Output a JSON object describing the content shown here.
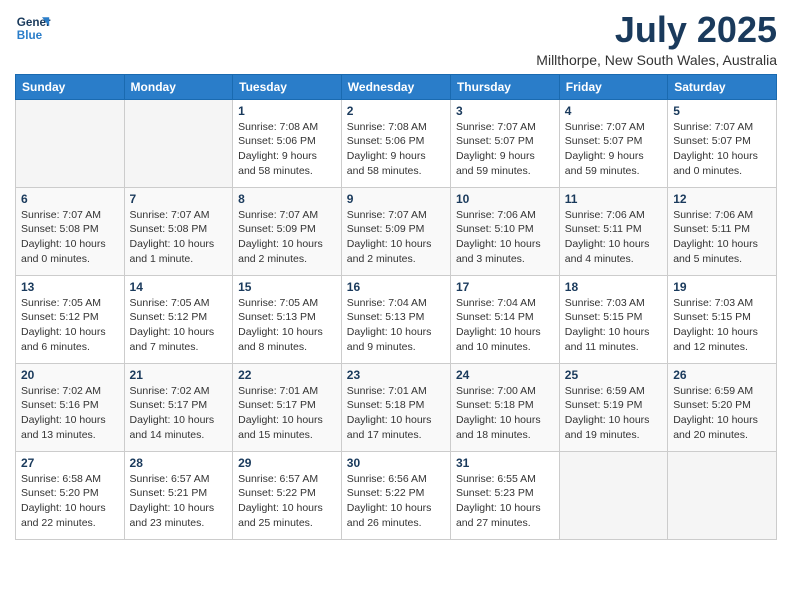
{
  "logo": {
    "line1": "General",
    "line2": "Blue"
  },
  "title": "July 2025",
  "subtitle": "Millthorpe, New South Wales, Australia",
  "days_of_week": [
    "Sunday",
    "Monday",
    "Tuesday",
    "Wednesday",
    "Thursday",
    "Friday",
    "Saturday"
  ],
  "weeks": [
    [
      {
        "day": "",
        "empty": true
      },
      {
        "day": "",
        "empty": true
      },
      {
        "day": "1",
        "sunrise": "7:08 AM",
        "sunset": "5:06 PM",
        "daylight": "9 hours and 58 minutes."
      },
      {
        "day": "2",
        "sunrise": "7:08 AM",
        "sunset": "5:06 PM",
        "daylight": "9 hours and 58 minutes."
      },
      {
        "day": "3",
        "sunrise": "7:07 AM",
        "sunset": "5:07 PM",
        "daylight": "9 hours and 59 minutes."
      },
      {
        "day": "4",
        "sunrise": "7:07 AM",
        "sunset": "5:07 PM",
        "daylight": "9 hours and 59 minutes."
      },
      {
        "day": "5",
        "sunrise": "7:07 AM",
        "sunset": "5:07 PM",
        "daylight": "10 hours and 0 minutes."
      }
    ],
    [
      {
        "day": "6",
        "sunrise": "7:07 AM",
        "sunset": "5:08 PM",
        "daylight": "10 hours and 0 minutes."
      },
      {
        "day": "7",
        "sunrise": "7:07 AM",
        "sunset": "5:08 PM",
        "daylight": "10 hours and 1 minute."
      },
      {
        "day": "8",
        "sunrise": "7:07 AM",
        "sunset": "5:09 PM",
        "daylight": "10 hours and 2 minutes."
      },
      {
        "day": "9",
        "sunrise": "7:07 AM",
        "sunset": "5:09 PM",
        "daylight": "10 hours and 2 minutes."
      },
      {
        "day": "10",
        "sunrise": "7:06 AM",
        "sunset": "5:10 PM",
        "daylight": "10 hours and 3 minutes."
      },
      {
        "day": "11",
        "sunrise": "7:06 AM",
        "sunset": "5:11 PM",
        "daylight": "10 hours and 4 minutes."
      },
      {
        "day": "12",
        "sunrise": "7:06 AM",
        "sunset": "5:11 PM",
        "daylight": "10 hours and 5 minutes."
      }
    ],
    [
      {
        "day": "13",
        "sunrise": "7:05 AM",
        "sunset": "5:12 PM",
        "daylight": "10 hours and 6 minutes."
      },
      {
        "day": "14",
        "sunrise": "7:05 AM",
        "sunset": "5:12 PM",
        "daylight": "10 hours and 7 minutes."
      },
      {
        "day": "15",
        "sunrise": "7:05 AM",
        "sunset": "5:13 PM",
        "daylight": "10 hours and 8 minutes."
      },
      {
        "day": "16",
        "sunrise": "7:04 AM",
        "sunset": "5:13 PM",
        "daylight": "10 hours and 9 minutes."
      },
      {
        "day": "17",
        "sunrise": "7:04 AM",
        "sunset": "5:14 PM",
        "daylight": "10 hours and 10 minutes."
      },
      {
        "day": "18",
        "sunrise": "7:03 AM",
        "sunset": "5:15 PM",
        "daylight": "10 hours and 11 minutes."
      },
      {
        "day": "19",
        "sunrise": "7:03 AM",
        "sunset": "5:15 PM",
        "daylight": "10 hours and 12 minutes."
      }
    ],
    [
      {
        "day": "20",
        "sunrise": "7:02 AM",
        "sunset": "5:16 PM",
        "daylight": "10 hours and 13 minutes."
      },
      {
        "day": "21",
        "sunrise": "7:02 AM",
        "sunset": "5:17 PM",
        "daylight": "10 hours and 14 minutes."
      },
      {
        "day": "22",
        "sunrise": "7:01 AM",
        "sunset": "5:17 PM",
        "daylight": "10 hours and 15 minutes."
      },
      {
        "day": "23",
        "sunrise": "7:01 AM",
        "sunset": "5:18 PM",
        "daylight": "10 hours and 17 minutes."
      },
      {
        "day": "24",
        "sunrise": "7:00 AM",
        "sunset": "5:18 PM",
        "daylight": "10 hours and 18 minutes."
      },
      {
        "day": "25",
        "sunrise": "6:59 AM",
        "sunset": "5:19 PM",
        "daylight": "10 hours and 19 minutes."
      },
      {
        "day": "26",
        "sunrise": "6:59 AM",
        "sunset": "5:20 PM",
        "daylight": "10 hours and 20 minutes."
      }
    ],
    [
      {
        "day": "27",
        "sunrise": "6:58 AM",
        "sunset": "5:20 PM",
        "daylight": "10 hours and 22 minutes."
      },
      {
        "day": "28",
        "sunrise": "6:57 AM",
        "sunset": "5:21 PM",
        "daylight": "10 hours and 23 minutes."
      },
      {
        "day": "29",
        "sunrise": "6:57 AM",
        "sunset": "5:22 PM",
        "daylight": "10 hours and 25 minutes."
      },
      {
        "day": "30",
        "sunrise": "6:56 AM",
        "sunset": "5:22 PM",
        "daylight": "10 hours and 26 minutes."
      },
      {
        "day": "31",
        "sunrise": "6:55 AM",
        "sunset": "5:23 PM",
        "daylight": "10 hours and 27 minutes."
      },
      {
        "day": "",
        "empty": true
      },
      {
        "day": "",
        "empty": true
      }
    ]
  ]
}
